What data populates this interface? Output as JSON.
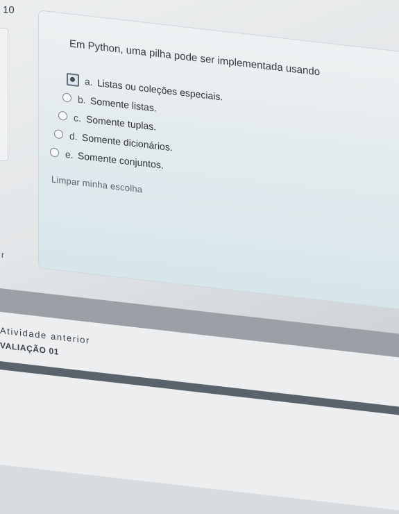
{
  "question": {
    "number": "10",
    "text": "Em Python, uma pilha pode ser implementada usando",
    "options": [
      {
        "letter": "a.",
        "label": "Listas ou coleções especiais.",
        "selected": true
      },
      {
        "letter": "b.",
        "label": "Somente listas.",
        "selected": false
      },
      {
        "letter": "c.",
        "label": "Somente tuplas.",
        "selected": false
      },
      {
        "letter": "d.",
        "label": "Somente dicionários.",
        "selected": false
      },
      {
        "letter": "e.",
        "label": "Somente conjuntos.",
        "selected": false
      }
    ],
    "clear_choice": "Limpar minha escolha"
  },
  "navigation": {
    "previous_label": "Atividade anterior",
    "previous_name": "VALIAÇÃO 01"
  },
  "left_edge": {
    "letter": "r"
  }
}
